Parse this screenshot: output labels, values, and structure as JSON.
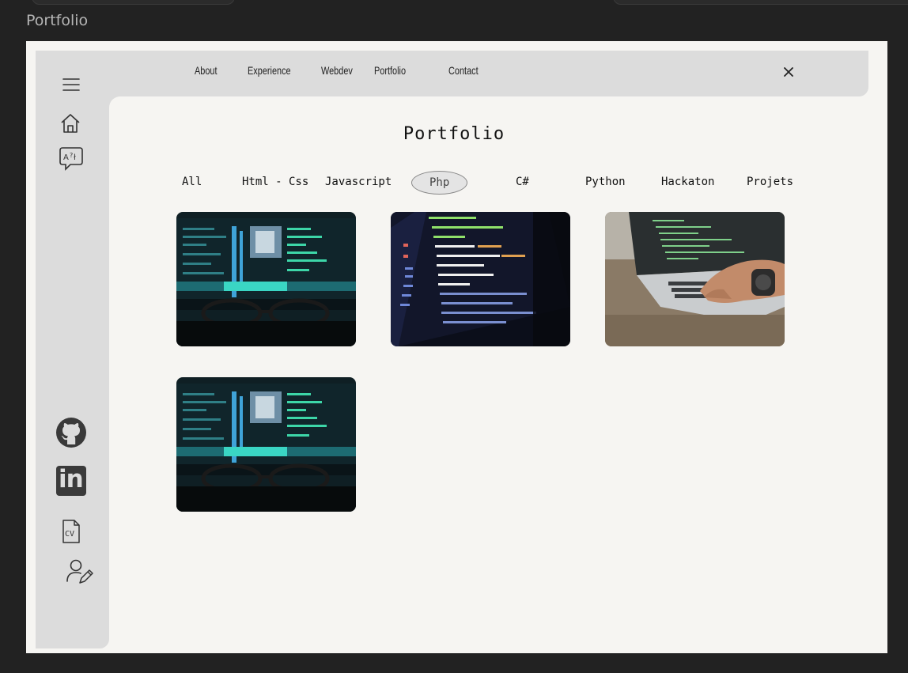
{
  "window": {
    "title": "Portfolio"
  },
  "nav": {
    "links": [
      "About",
      "Experience",
      "Webdev",
      "Portfolio",
      "Contact"
    ],
    "close_icon": "close-icon"
  },
  "sidebar": {
    "top_icons": [
      "menu-icon",
      "home-icon",
      "translate-icon"
    ],
    "bottom_icons": [
      "github-icon",
      "linkedin-icon",
      "cv-icon",
      "user-edit-icon"
    ],
    "cv_text": "CV",
    "linkedin_text": "in"
  },
  "page": {
    "title": "Portfolio",
    "filters": [
      "All",
      "Html - Css",
      "Javascript",
      "Php",
      "C#",
      "Python",
      "Hackaton",
      "Projets"
    ],
    "active_filter": "Php"
  },
  "projects": [
    {
      "image": "code-monitor-with-glasses"
    },
    {
      "image": "laptop-code-editor-dark"
    },
    {
      "image": "hands-typing-on-laptop"
    },
    {
      "image": "code-monitor-with-glasses"
    }
  ],
  "colors": {
    "background": "#222222",
    "panel": "#f6f5f2",
    "sidebar": "#dcdcdc"
  }
}
